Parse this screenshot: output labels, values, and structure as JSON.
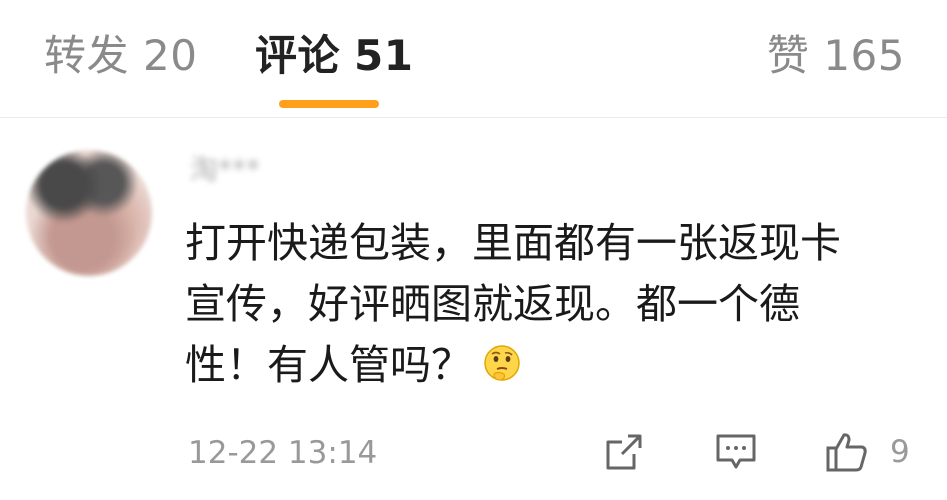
{
  "tabs": {
    "repost": {
      "label": "转发",
      "count": "20"
    },
    "comment": {
      "label": "评论",
      "count": "51",
      "active": true
    },
    "like": {
      "label": "赞",
      "count": "165"
    }
  },
  "comment": {
    "username": "淘***",
    "text_lines": [
      "打开快递包装，里面都有一张返现卡",
      "宣传，好评晒图就返现。都一个德",
      "性！有人管吗？"
    ],
    "emoji": "thinking-face-icon",
    "time": "12-22 13:14",
    "like_count": "9"
  },
  "colors": {
    "accent_underline": "#ff9f1a",
    "inactive_tab": "#8a8a8a",
    "meta_text": "#999999"
  }
}
